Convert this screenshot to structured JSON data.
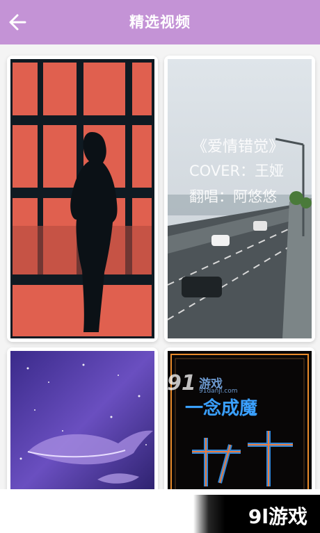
{
  "header": {
    "title": "精选视频",
    "back_icon": "arrow-left-icon",
    "background": "#c493d6"
  },
  "videos": [
    {
      "id_label": "silhouette-window"
    },
    {
      "id_label": "highway-cover",
      "caption_lines": [
        "《爱情错觉》",
        "COVER：王娅",
        "翻唱：阿悠悠"
      ]
    },
    {
      "id_label": "galaxy-whale"
    },
    {
      "id_label": "neon-sign",
      "neon_text": "一念成魔"
    }
  ],
  "watermarks": {
    "center_logo_num": "91",
    "center_logo_name": "游戏",
    "center_logo_url": "91danji.com",
    "corner_logo": "9l游戏"
  }
}
